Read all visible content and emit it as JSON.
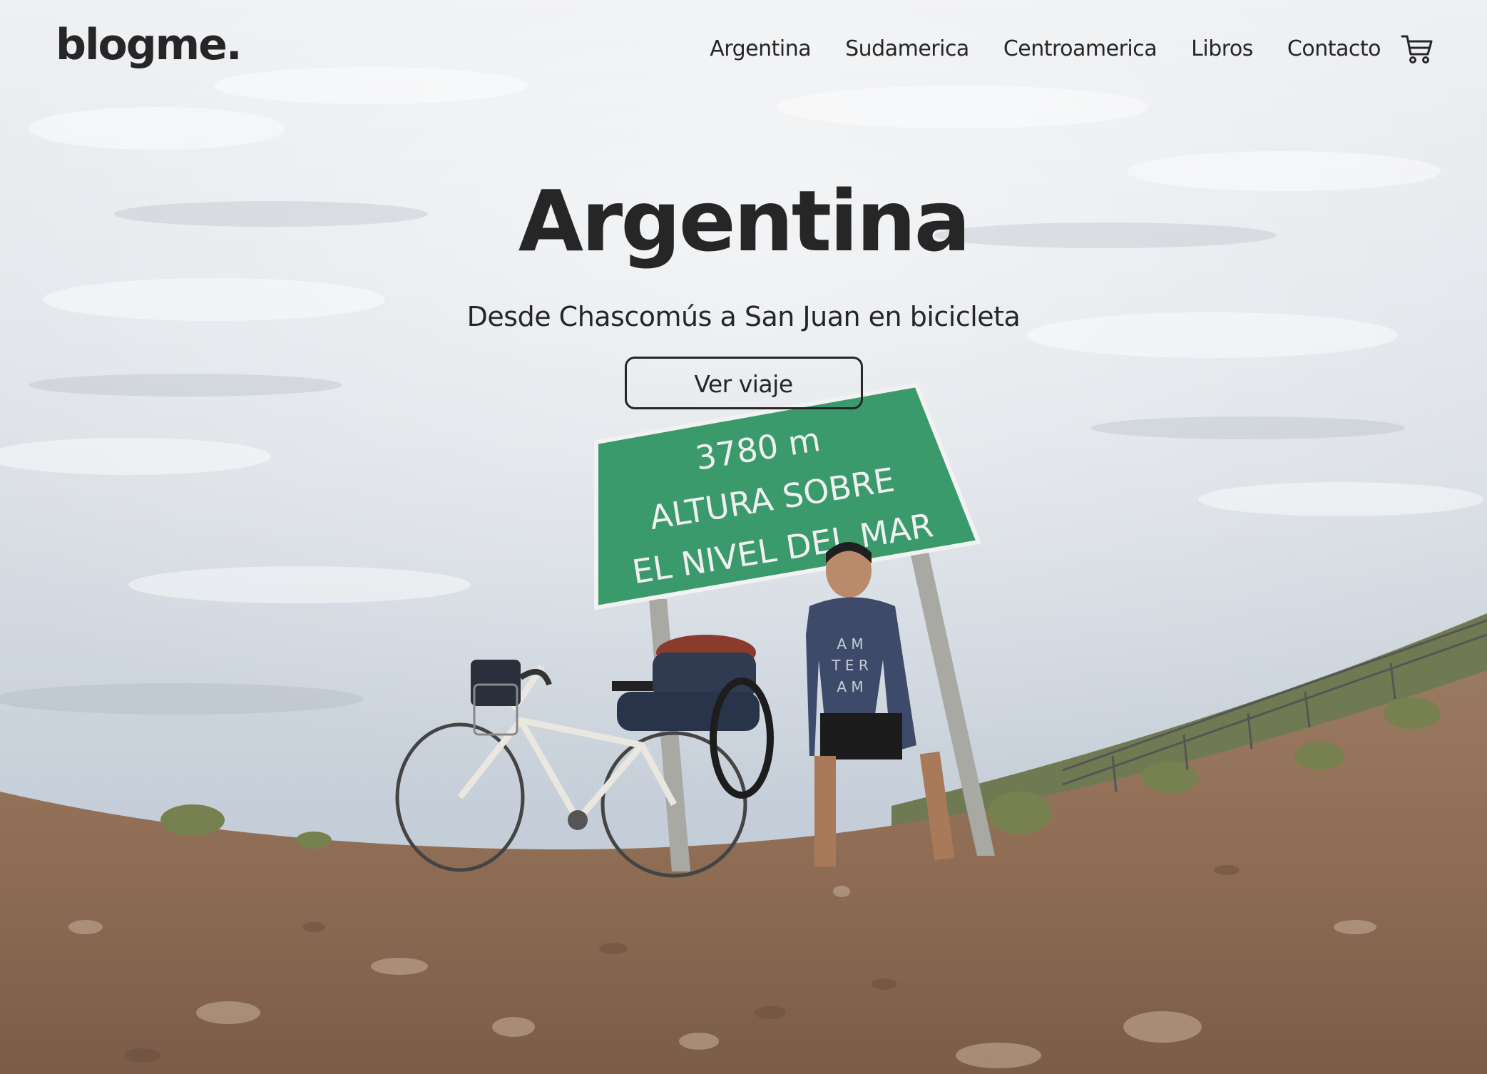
{
  "brand": {
    "logo": "blogme."
  },
  "nav": {
    "links": [
      "Argentina",
      "Sudamerica",
      "Centroamerica",
      "Libros",
      "Contacto"
    ],
    "cart_icon": "shopping-cart-icon"
  },
  "hero": {
    "title": "Argentina",
    "subtitle": "Desde Chascomús a San Juan en bicicleta",
    "button_label": "Ver viaje",
    "sign": {
      "line1": "3780 m",
      "line2": "ALTURA SOBRE",
      "line3": "EL NIVEL DEL MAR"
    },
    "shirt_letters": [
      "A M",
      "T E R",
      "A M"
    ]
  },
  "colors": {
    "text": "#262626",
    "sign_green": "#3a9a6c",
    "sky": "#dfe3e8",
    "ground": "#9b7558"
  }
}
